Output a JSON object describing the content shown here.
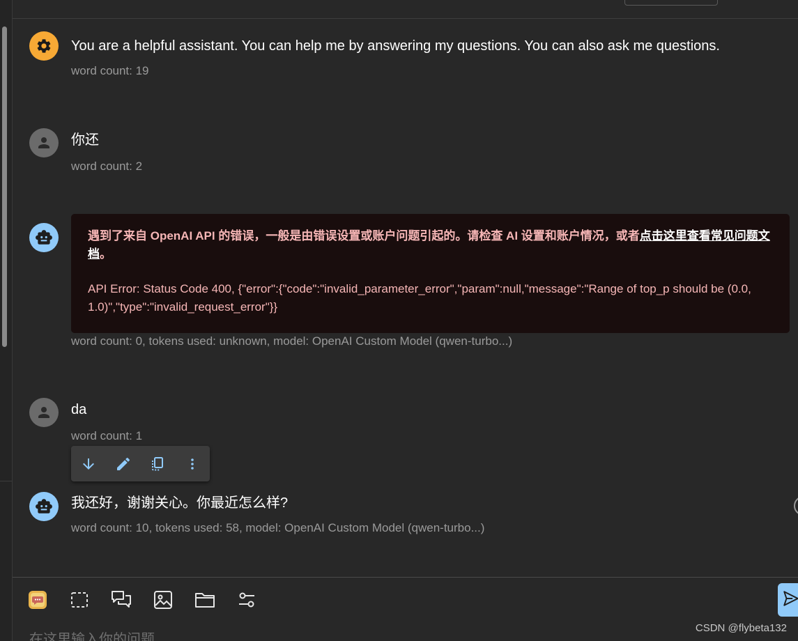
{
  "messages": [
    {
      "role": "system",
      "avatar_icon": "gear-icon",
      "text": "You are a helpful assistant. You can help me by answering my questions. You can also ask me questions.",
      "meta": "word count: 19"
    },
    {
      "role": "user",
      "avatar_icon": "person-icon",
      "text": "你还",
      "meta": "word count: 2"
    },
    {
      "role": "assistant",
      "avatar_icon": "robot-icon",
      "error": {
        "headline": "遇到了来自 OpenAI API 的错误，一般是由错误设置或账户问题引起的。请检查 AI 设置和账户情况，或者",
        "link": "点击这里查看常见问题文档",
        "headline_end": "。",
        "body": "API Error: Status Code 400, {\"error\":{\"code\":\"invalid_parameter_error\",\"param\":null,\"message\":\"Range of top_p should be (0.0, 1.0)\",\"type\":\"invalid_request_error\"}}"
      },
      "meta": "word count: 0, tokens used: unknown, model: OpenAI Custom Model (qwen-turbo...)"
    },
    {
      "role": "user",
      "avatar_icon": "person-icon",
      "text": "da",
      "meta": "word count: 1"
    },
    {
      "role": "assistant",
      "avatar_icon": "robot-icon",
      "text": "我还好，谢谢关心。你最近怎么样?",
      "meta": "word count: 10, tokens used: 58, model: OpenAI Custom Model (qwen-turbo...)"
    }
  ],
  "message_actions": [
    "arrow-down-icon",
    "edit-icon",
    "copy-icon",
    "more-vert-icon"
  ],
  "toolbar": {
    "icons": [
      "chat-app-icon",
      "selection-icon",
      "conversation-icon",
      "image-icon",
      "folder-icon",
      "settings-sliders-icon"
    ],
    "input_placeholder": "在这里输入你的问题...",
    "send_icon": "send-icon"
  },
  "watermark": "CSDN @flybeta132",
  "colors": {
    "background": "#282828",
    "system_avatar": "#f7a935",
    "user_avatar": "#6b6b6b",
    "bot_avatar": "#90caf9",
    "error_bg": "#190d0d",
    "error_text": "#f6b6b6",
    "meta_text": "#9a9a9a",
    "accent": "#90caf9"
  }
}
